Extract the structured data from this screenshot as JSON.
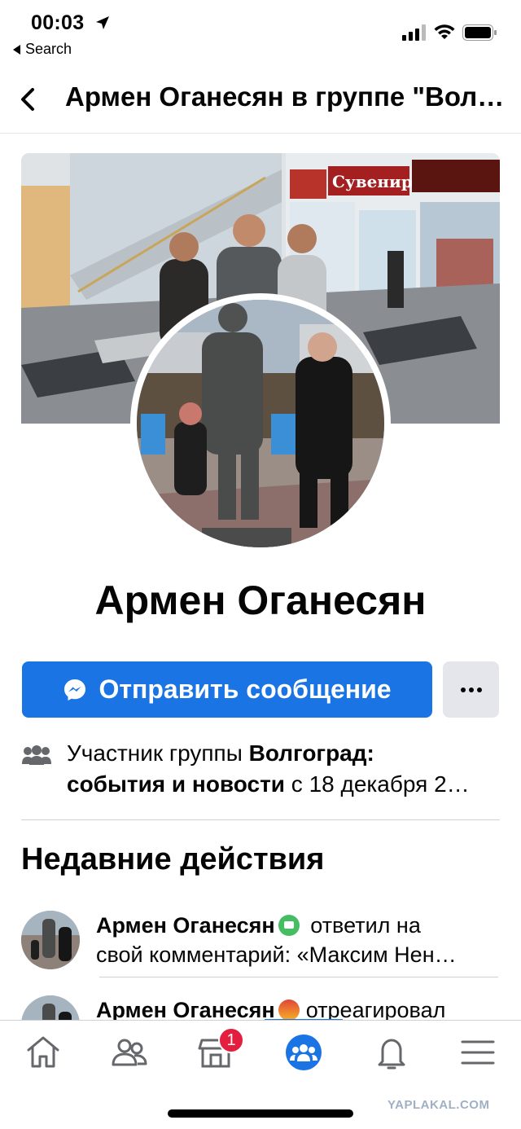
{
  "status_bar": {
    "time": "00:03",
    "back_app": "Search",
    "icons": [
      "location-arrow-icon",
      "signal-icon",
      "wifi-icon",
      "battery-icon"
    ]
  },
  "header": {
    "back_icon": "chevron-left-icon",
    "title": "Армен Оганесян в группе \"Волгоград: события и новости\""
  },
  "profile": {
    "name": "Армен Оганесян",
    "message_button": "Отправить сообщение",
    "message_icon": "messenger-icon",
    "more_icon": "more-dots-icon"
  },
  "group_membership": {
    "icon": "group-members-icon",
    "prefix": "Участник группы ",
    "group_name_part1": "Волгоград:",
    "group_name_part2": "события и новости",
    "since": " с 18 декабря 2…"
  },
  "recent_activity": {
    "title": "Недавние действия",
    "items": [
      {
        "author": "Армен Оганесян",
        "badge": "comment-badge-icon",
        "action": "ответил на",
        "detail": "свой комментарий: «Максим Нен…"
      },
      {
        "author": "Армен Оганесян",
        "badge": "angry-reaction-icon",
        "action": "отреагировал",
        "detail": ""
      }
    ]
  },
  "tab_bar": {
    "tabs": [
      "home-icon",
      "friends-icon",
      "marketplace-icon",
      "groups-icon",
      "notifications-icon",
      "menu-icon"
    ],
    "active": "groups-icon",
    "marketplace_badge": "1"
  },
  "watermark": "YAPLAKAL.COM",
  "colors": {
    "accent": "#1b74e4",
    "badge": "#e41e3f",
    "secondary_button": "#e4e6eb"
  }
}
